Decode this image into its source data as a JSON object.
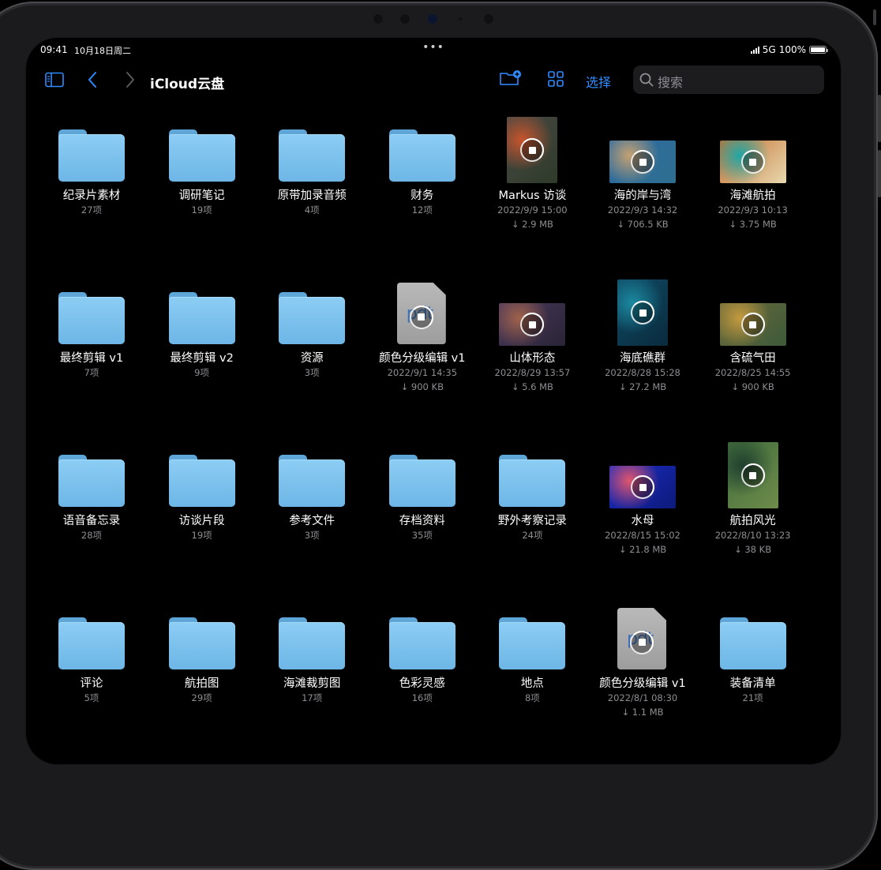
{
  "status": {
    "time": "09:41",
    "date": "10月18日周二",
    "network": "5G",
    "battery": "100%",
    "battery_level": 1.0
  },
  "toolbar": {
    "title": "iCloud云盘",
    "select_label": "选择",
    "search_placeholder": "搜索"
  },
  "items": [
    {
      "type": "folder",
      "name": "纪录片素材",
      "info": "27项"
    },
    {
      "type": "folder",
      "name": "调研笔记",
      "info": "19项"
    },
    {
      "type": "folder",
      "name": "原带加录音频",
      "info": "4项"
    },
    {
      "type": "folder",
      "name": "财务",
      "info": "12项"
    },
    {
      "type": "video",
      "name": "Markus 访谈",
      "date": "2022/9/9 15:00",
      "size": "↓ 2.9 MB",
      "colors": [
        "#4a4a45",
        "#c8542c",
        "#2e3a2a"
      ],
      "shape": "portrait"
    },
    {
      "type": "video",
      "name": "海的岸与湾",
      "date": "2022/9/3 14:32",
      "size": "↓ 706.5 KB",
      "colors": [
        "#2b6aa3",
        "#c5a172",
        "#2f6f8f"
      ],
      "shape": "landscape"
    },
    {
      "type": "video",
      "name": "海滩航拍",
      "date": "2022/9/3 10:13",
      "size": "↓ 3.75 MB",
      "colors": [
        "#c46c2c",
        "#1fa6a5",
        "#e8d9b0"
      ],
      "shape": "landscape"
    },
    {
      "type": "folder",
      "name": "最终剪辑 v1",
      "info": "7项"
    },
    {
      "type": "folder",
      "name": "最终剪辑 v2",
      "info": "9项"
    },
    {
      "type": "folder",
      "name": "资源",
      "info": "3项"
    },
    {
      "type": "pdf",
      "name": "颜色分级编辑 v1",
      "date": "2022/9/1 14:35",
      "size": "↓ 900 KB",
      "logo": "pdt"
    },
    {
      "type": "video",
      "name": "山体形态",
      "date": "2022/8/29 13:57",
      "size": "↓ 5.6 MB",
      "colors": [
        "#4b3a5e",
        "#a0624a",
        "#2a2436"
      ],
      "shape": "landscape"
    },
    {
      "type": "video",
      "name": "海底礁群",
      "date": "2022/8/28 15:28",
      "size": "↓ 27.2 MB",
      "colors": [
        "#0f4b66",
        "#1b8aa0",
        "#0a2b3d"
      ],
      "shape": "portrait"
    },
    {
      "type": "video",
      "name": "含硫气田",
      "date": "2022/8/25 14:55",
      "size": "↓ 900 KB",
      "colors": [
        "#6d6a3a",
        "#c49a3f",
        "#3d5a3a"
      ],
      "shape": "landscape"
    },
    {
      "type": "folder",
      "name": "语音备忘录",
      "info": "28项"
    },
    {
      "type": "folder",
      "name": "访谈片段",
      "info": "19项"
    },
    {
      "type": "folder",
      "name": "参考文件",
      "info": "3项"
    },
    {
      "type": "folder",
      "name": "存档资料",
      "info": "35项"
    },
    {
      "type": "folder",
      "name": "野外考察记录",
      "info": "24项"
    },
    {
      "type": "video",
      "name": "水母",
      "date": "2022/8/15 15:02",
      "size": "↓ 21.8 MB",
      "colors": [
        "#1b2dc6",
        "#e0566d",
        "#0d1a7a"
      ],
      "shape": "landscape"
    },
    {
      "type": "video",
      "name": "航拍风光",
      "date": "2022/8/10 13:23",
      "size": "↓ 38 KB",
      "colors": [
        "#3e6b3c",
        "#1f3f2e",
        "#6f8c4a"
      ],
      "shape": "portrait"
    },
    {
      "type": "folder",
      "name": "评论",
      "info": "5项"
    },
    {
      "type": "folder",
      "name": "航拍图",
      "info": "29项"
    },
    {
      "type": "folder",
      "name": "海滩裁剪图",
      "info": "17项"
    },
    {
      "type": "folder",
      "name": "色彩灵感",
      "info": "16项"
    },
    {
      "type": "folder",
      "name": "地点",
      "info": "8项"
    },
    {
      "type": "pdf",
      "name": "颜色分级编辑 v1",
      "date": "2022/8/1 08:30",
      "size": "↓ 1.1 MB",
      "logo": "pdt"
    },
    {
      "type": "folder",
      "name": "装备清单",
      "info": "21项"
    }
  ]
}
